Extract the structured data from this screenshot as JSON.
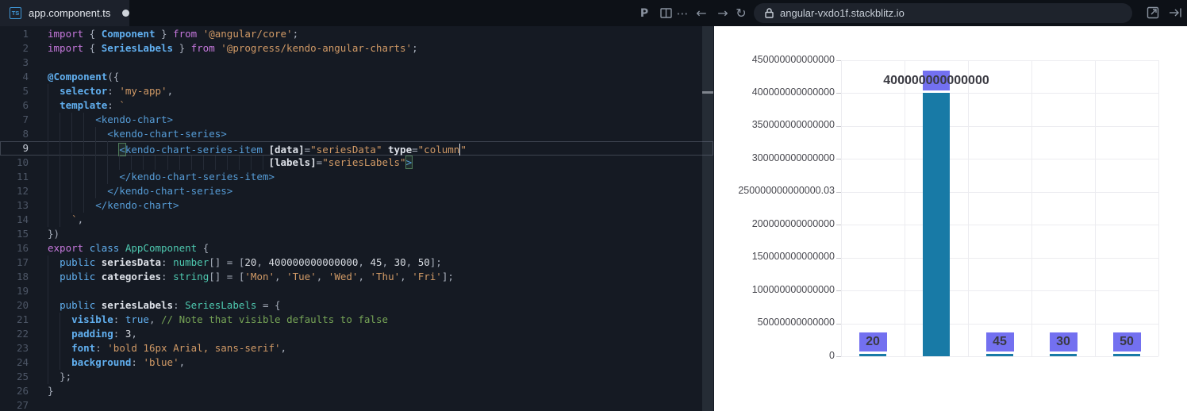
{
  "titlebar": {
    "tab": {
      "label": "app.component.ts",
      "type_badge": "TS",
      "modified": true
    },
    "icons": {
      "prettier": "P",
      "ellipsis": "⋯",
      "back": "←",
      "forward": "→",
      "reload": "↻"
    },
    "url": "angular-vxdo1f.stackblitz.io"
  },
  "editor": {
    "lines": [
      {
        "n": 1,
        "g": 0,
        "seg": [
          [
            "kw",
            "import"
          ],
          [
            "p",
            " { "
          ],
          [
            "bb",
            "Component"
          ],
          [
            "p",
            " } "
          ],
          [
            "kw",
            "from"
          ],
          [
            "p",
            " "
          ],
          [
            "s",
            "'@angular/core'"
          ],
          [
            "p",
            ";"
          ]
        ]
      },
      {
        "n": 2,
        "g": 0,
        "seg": [
          [
            "kw",
            "import"
          ],
          [
            "p",
            " { "
          ],
          [
            "bb",
            "SeriesLabels"
          ],
          [
            "p",
            " } "
          ],
          [
            "kw",
            "from"
          ],
          [
            "p",
            " "
          ],
          [
            "s",
            "'@progress/kendo-angular-charts'"
          ],
          [
            "p",
            ";"
          ]
        ]
      },
      {
        "n": 3,
        "g": 0,
        "seg": []
      },
      {
        "n": 4,
        "g": 0,
        "seg": [
          [
            "bb",
            "@Component"
          ],
          [
            "p",
            "({"
          ]
        ]
      },
      {
        "n": 5,
        "g": 1,
        "seg": [
          [
            "p",
            "  "
          ],
          [
            "bb",
            "selector"
          ],
          [
            "p",
            ": "
          ],
          [
            "s",
            "'my-app'"
          ],
          [
            "p",
            ","
          ]
        ]
      },
      {
        "n": 6,
        "g": 1,
        "seg": [
          [
            "p",
            "  "
          ],
          [
            "bb",
            "template"
          ],
          [
            "p",
            ": "
          ],
          [
            "s",
            "`"
          ]
        ]
      },
      {
        "n": 7,
        "g": 4,
        "seg": [
          [
            "p",
            "        "
          ],
          [
            "tag",
            "<kendo-chart>"
          ]
        ]
      },
      {
        "n": 8,
        "g": 5,
        "seg": [
          [
            "p",
            "          "
          ],
          [
            "tag",
            "<kendo-chart-series>"
          ]
        ]
      },
      {
        "n": 9,
        "g": 6,
        "active": true,
        "seg": [
          [
            "p",
            "            "
          ],
          [
            "tag bm",
            "<"
          ],
          [
            "tag",
            "kendo-chart-series-item"
          ],
          [
            "p",
            " "
          ],
          [
            "wb",
            "[data]"
          ],
          [
            "p",
            "="
          ],
          [
            "s",
            "\"seriesData\""
          ],
          [
            "p",
            " "
          ],
          [
            "wb",
            "type"
          ],
          [
            "p",
            "="
          ],
          [
            "s",
            "\"column"
          ],
          [
            "cursor",
            ""
          ],
          [
            "s",
            "\""
          ]
        ]
      },
      {
        "n": 10,
        "g": 19,
        "seg": [
          [
            "p",
            "                                     "
          ],
          [
            "wb",
            "[labels]"
          ],
          [
            "p",
            "="
          ],
          [
            "s",
            "\"seriesLabels\""
          ],
          [
            "tag bm",
            ">"
          ]
        ]
      },
      {
        "n": 11,
        "g": 6,
        "seg": [
          [
            "p",
            "            "
          ],
          [
            "tag",
            "</kendo-chart-series-item>"
          ]
        ]
      },
      {
        "n": 12,
        "g": 5,
        "seg": [
          [
            "p",
            "          "
          ],
          [
            "tag",
            "</kendo-chart-series>"
          ]
        ]
      },
      {
        "n": 13,
        "g": 4,
        "seg": [
          [
            "p",
            "        "
          ],
          [
            "tag",
            "</kendo-chart>"
          ]
        ]
      },
      {
        "n": 14,
        "g": 2,
        "seg": [
          [
            "p",
            "    "
          ],
          [
            "s",
            "`"
          ],
          [
            "p",
            ","
          ]
        ]
      },
      {
        "n": 15,
        "g": 0,
        "seg": [
          [
            "p",
            "})"
          ]
        ]
      },
      {
        "n": 16,
        "g": 0,
        "seg": [
          [
            "kw",
            "export"
          ],
          [
            "p",
            " "
          ],
          [
            "kb",
            "class"
          ],
          [
            "p",
            " "
          ],
          [
            "ty",
            "AppComponent"
          ],
          [
            "p",
            " {"
          ]
        ]
      },
      {
        "n": 17,
        "g": 1,
        "seg": [
          [
            "p",
            "  "
          ],
          [
            "kb",
            "public"
          ],
          [
            "p",
            " "
          ],
          [
            "wb",
            "seriesData"
          ],
          [
            "p",
            ": "
          ],
          [
            "ty",
            "number"
          ],
          [
            "p",
            "[] = ["
          ],
          [
            "n",
            "20"
          ],
          [
            "p",
            ", "
          ],
          [
            "n",
            "400000000000000"
          ],
          [
            "p",
            ", "
          ],
          [
            "n",
            "45"
          ],
          [
            "p",
            ", "
          ],
          [
            "n",
            "30"
          ],
          [
            "p",
            ", "
          ],
          [
            "n",
            "50"
          ],
          [
            "p",
            "];"
          ]
        ]
      },
      {
        "n": 18,
        "g": 1,
        "seg": [
          [
            "p",
            "  "
          ],
          [
            "kb",
            "public"
          ],
          [
            "p",
            " "
          ],
          [
            "wb",
            "categories"
          ],
          [
            "p",
            ": "
          ],
          [
            "ty",
            "string"
          ],
          [
            "p",
            "[] = ["
          ],
          [
            "s",
            "'Mon'"
          ],
          [
            "p",
            ", "
          ],
          [
            "s",
            "'Tue'"
          ],
          [
            "p",
            ", "
          ],
          [
            "s",
            "'Wed'"
          ],
          [
            "p",
            ", "
          ],
          [
            "s",
            "'Thu'"
          ],
          [
            "p",
            ", "
          ],
          [
            "s",
            "'Fri'"
          ],
          [
            "p",
            "];"
          ]
        ]
      },
      {
        "n": 19,
        "g": 1,
        "seg": []
      },
      {
        "n": 20,
        "g": 1,
        "seg": [
          [
            "p",
            "  "
          ],
          [
            "kb",
            "public"
          ],
          [
            "p",
            " "
          ],
          [
            "wb",
            "seriesLabels"
          ],
          [
            "p",
            ": "
          ],
          [
            "ty",
            "SeriesLabels"
          ],
          [
            "p",
            " = {"
          ]
        ]
      },
      {
        "n": 21,
        "g": 2,
        "seg": [
          [
            "p",
            "    "
          ],
          [
            "bb",
            "visible"
          ],
          [
            "p",
            ": "
          ],
          [
            "kb",
            "true"
          ],
          [
            "p",
            ", "
          ],
          [
            "c",
            "// Note that visible defaults to false"
          ]
        ]
      },
      {
        "n": 22,
        "g": 2,
        "seg": [
          [
            "p",
            "    "
          ],
          [
            "bb",
            "padding"
          ],
          [
            "p",
            ": "
          ],
          [
            "n",
            "3"
          ],
          [
            "p",
            ","
          ]
        ]
      },
      {
        "n": 23,
        "g": 2,
        "seg": [
          [
            "p",
            "    "
          ],
          [
            "bb",
            "font"
          ],
          [
            "p",
            ": "
          ],
          [
            "s",
            "'bold 16px Arial, sans-serif'"
          ],
          [
            "p",
            ","
          ]
        ]
      },
      {
        "n": 24,
        "g": 2,
        "seg": [
          [
            "p",
            "    "
          ],
          [
            "bb",
            "background"
          ],
          [
            "p",
            ": "
          ],
          [
            "s",
            "'blue'"
          ],
          [
            "p",
            ","
          ]
        ]
      },
      {
        "n": 25,
        "g": 1,
        "seg": [
          [
            "p",
            "  "
          ],
          [
            "p",
            "};"
          ]
        ]
      },
      {
        "n": 26,
        "g": 0,
        "seg": [
          [
            "p",
            "}"
          ]
        ]
      },
      {
        "n": 27,
        "g": 0,
        "seg": []
      }
    ]
  },
  "chart_data": {
    "type": "bar",
    "categories": [
      "Mon",
      "Tue",
      "Wed",
      "Thu",
      "Fri"
    ],
    "series": [
      {
        "name": "seriesData",
        "values": [
          20,
          400000000000000,
          45,
          30,
          50
        ]
      }
    ],
    "value_labels": [
      "20",
      "400000000000000",
      "45",
      "30",
      "50"
    ],
    "title": "",
    "xlabel": "",
    "ylabel": "",
    "ylim": [
      0,
      450000000000000
    ],
    "y_tick_labels": [
      "450000000000000",
      "400000000000000",
      "350000000000000",
      "300000000000000",
      "250000000000000.03",
      "200000000000000",
      "150000000000000",
      "100000000000000",
      "50000000000000",
      "0"
    ],
    "x_tick_labels": [],
    "grid": true,
    "legend": "none",
    "bar_color": "#187aa6",
    "label_badge_color": "#7370f0",
    "label_text_color": "#3a3a42"
  }
}
